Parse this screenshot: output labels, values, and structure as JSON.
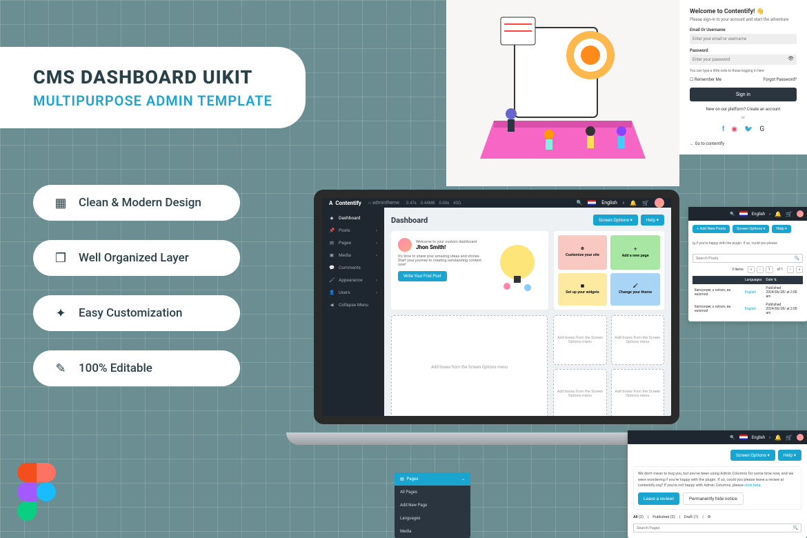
{
  "hero": {
    "title": "CMS DASHBOARD UIKIT",
    "subtitle": "MULTIPURPOSE ADMIN TEMPLATE"
  },
  "features": [
    "Clean & Modern Design",
    "Well Organized Layer",
    "Easy Customization",
    "100% Editable"
  ],
  "login": {
    "title": "Welcome to Contentify! 👋",
    "subtitle": "Please sign-in to your account and start the adventure",
    "email_label": "Email Or Username",
    "email_placeholder": "Enter your email or username",
    "pass_label": "Password",
    "pass_placeholder": "Enter your password",
    "note": "You can type a little note to those logging in here",
    "remember": "Remember Me",
    "forgot": "Forgot Password?",
    "signin": "Sign in",
    "new": "New on our platform? Create an account",
    "or": "or",
    "back": "← Go to contentify"
  },
  "dashboard": {
    "brand": "Contentify",
    "site": "admintheme",
    "stats": [
      "0.47s",
      "0.44MB",
      "0.00s",
      "43Q"
    ],
    "lang": "English",
    "nav": [
      "Dashboard",
      "Posts",
      "Pages",
      "Media",
      "Comments",
      "Appearance",
      "Users",
      "Collapse Menu"
    ],
    "title": "Dashboard",
    "screen_opts": "Screen Options",
    "help": "Help",
    "welcome_label": "Welcome to your custom dashboard",
    "welcome_name": "Jhon Smith!",
    "welcome_desc": "It's time to share your amazing ideas and stories. Start your journey to creating outstanding content now!",
    "write_post": "Write Your Frist Post",
    "tiles": [
      "Customize your site",
      "Add a new page",
      "Set up your widgets",
      "Change your theme"
    ],
    "addbox": "Add boxes from the Screen Options menu",
    "addbox_sm": "Add boxes from the Screen Options menu"
  },
  "posts_panel": {
    "add_new": "+ Add New Posts",
    "screen_opts": "Screen Options",
    "help": "Help",
    "msg": "ig if you're happy with the  plugin. If so, could you please",
    "search_ph": "Search Posts",
    "items": "3 Items",
    "page_of": "of 1",
    "hdr_lang": "Languages",
    "hdr_date": "Date",
    "cell_text": "llamcorper, s rutrum, ea euismod",
    "cell_lang": "English",
    "cell_status": "Published",
    "cell_date": "2024/06/28/ at 2:00 am"
  },
  "pages_panel": {
    "screen_opts": "Screen Options",
    "help": "Help",
    "msg1": "We don't mean to bug you, but you've been using Admin Columns for some time now, and we were wondering if you're happy with the  plugin. If so, could you please leave a review at contentify.org? If  you're not happy with Admin Columns, please ",
    "click_here": "click here",
    "leave_review": "Leave a review!",
    "hide_notice": "Permanently hide notice",
    "filters": {
      "all": "All",
      "all_n": "(2)",
      "pub": "Published",
      "pub_n": "(2)",
      "draft": "Draft",
      "draft_n": "(1)"
    },
    "search_ph": "Search Pages"
  },
  "dropdown": {
    "title": "Pages",
    "items": [
      "All Pages",
      "Add New Page",
      "Languages",
      "Media"
    ]
  }
}
